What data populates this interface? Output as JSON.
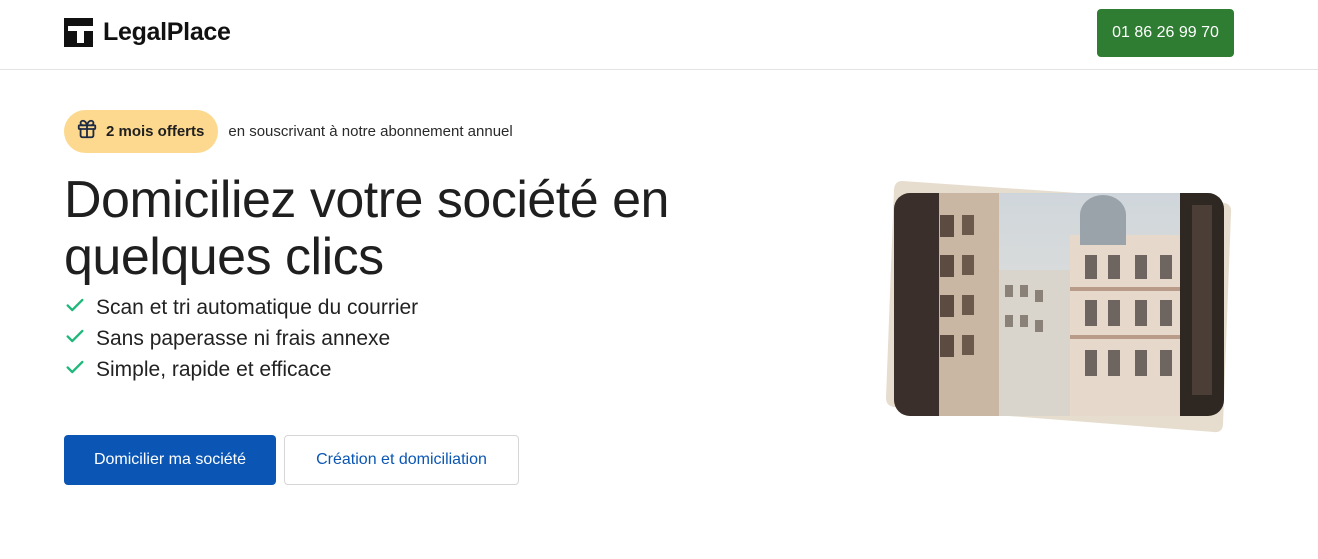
{
  "header": {
    "logo_text": "LegalPlace",
    "phone_label": "01 86 26 99 70"
  },
  "promo": {
    "badge_label": "2 mois offerts",
    "text": "en souscrivant à notre abonnement annuel"
  },
  "hero": {
    "title_line1": "Domiciliez votre société en",
    "title_line2": "quelques clics",
    "features": [
      "Scan et tri automatique du courrier",
      "Sans paperasse ni frais annexe",
      "Simple, rapide et efficace"
    ],
    "primary_cta": "Domicilier ma société",
    "secondary_cta": "Création et domiciliation"
  },
  "colors": {
    "accent_green": "#2f7d32",
    "accent_blue": "#0b56b4",
    "badge_yellow": "#fcd98e",
    "check_green": "#1fb87a"
  },
  "icons": {
    "logo": "legalplace-logo-icon",
    "gift": "gift-icon",
    "check": "check-icon"
  }
}
